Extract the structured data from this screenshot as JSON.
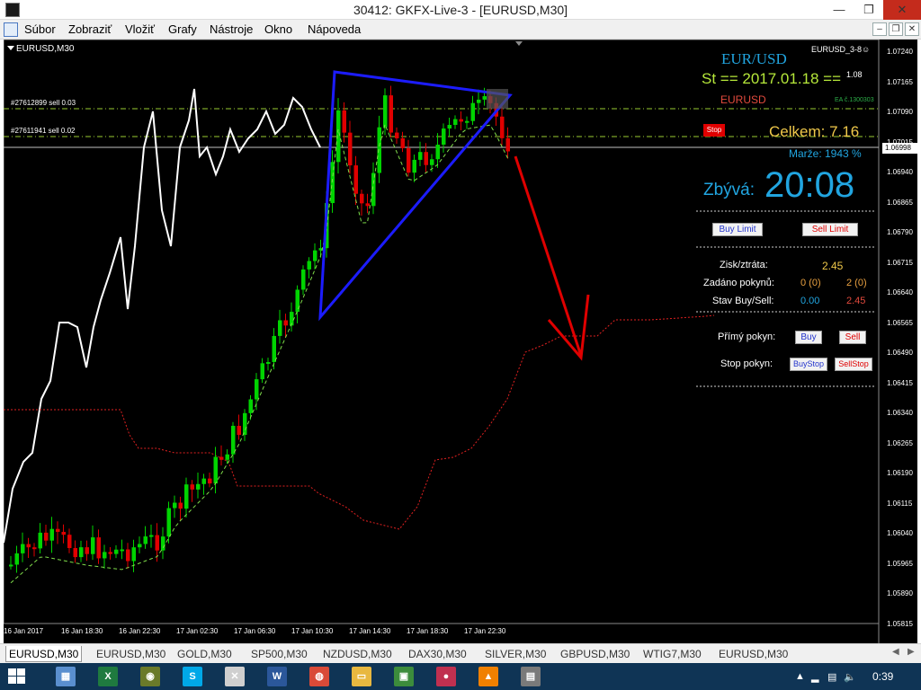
{
  "window": {
    "title": "30412: GKFX-Live-3 - [EURUSD,M30]",
    "min_glyph": "—",
    "max_glyph": "❐",
    "close_glyph": "✕"
  },
  "menu": {
    "items": [
      "Súbor",
      "Zobraziť",
      "Vložiť",
      "Grafy",
      "Nástroje",
      "Okno",
      "Nápoveda"
    ],
    "mdi_min": "–",
    "mdi_restore": "❐",
    "mdi_close": "✕"
  },
  "chart": {
    "symbol_label": "EURUSD,M30",
    "ea_name": "EURUSD_3-8☺",
    "orders": [
      "#27612899 sell 0.03",
      "#27611941 sell 0.02"
    ],
    "price_ticks": [
      "1.07240",
      "1.07165",
      "1.07090",
      "1.07015",
      "1.06940",
      "1.06865",
      "1.06790",
      "1.06715",
      "1.06640",
      "1.06565",
      "1.06490",
      "1.06415",
      "1.06340",
      "1.06265",
      "1.06190",
      "1.06115",
      "1.06040",
      "1.05965",
      "1.05890",
      "1.05815"
    ],
    "current_price": "1.06998",
    "time_ticks": [
      "16 Jan 2017",
      "16 Jan 18:30",
      "16 Jan 22:30",
      "17 Jan 02:30",
      "17 Jan 06:30",
      "17 Jan 10:30",
      "17 Jan 14:30",
      "17 Jan 18:30",
      "17 Jan 22:30"
    ],
    "colors": {
      "bull": "#00d400",
      "bear": "#e00000",
      "triangle": "#1c1cff",
      "arrow": "#e00000",
      "white_line": "#ffffff",
      "ichimoku": "#e02020"
    }
  },
  "panel": {
    "pair": "EUR/USD",
    "date_line": "St  ==  2017.01.18  ==",
    "date_suffix": "1.08",
    "eurusd": "EURUSD",
    "ea_number": "EA č.1300303",
    "stop_button": "Stop",
    "celkem": "Celkem: 7.16",
    "marze": "Marže:  1943  %",
    "zbyva_label": "Zbývá:",
    "zbyva_time": "20:08",
    "buy_limit": "Buy Limit",
    "sell_limit": "Sell Limit",
    "zisk_label": "Zisk/ztráta:",
    "zisk_value": "2.45",
    "zadano_label": "Zadáno pokynů:",
    "zadano_buy": "0 (0)",
    "zadano_sell": "2 (0)",
    "stav_label": "Stav Buy/Sell:",
    "stav_buy": "0.00",
    "stav_sell": "2.45",
    "primy_label": "Přímý pokyn:",
    "buy": "Buy",
    "sell": "Sell",
    "stop_label": "Stop pokyn:",
    "buy_stop": "BuyStop",
    "sell_stop": "SellStop"
  },
  "tabs": {
    "items": [
      "EURUSD,M30",
      "EURUSD,M30",
      "GOLD,M30",
      "SP500,M30",
      "NZDUSD,M30",
      "DAX30,M30",
      "SILVER,M30",
      "GBPUSD,M30",
      "WTIG7,M30",
      "EURUSD,M30"
    ],
    "active": 0,
    "scroll_left": "◀",
    "scroll_right": "▶"
  },
  "taskbar": {
    "clock": "0:39",
    "apps": [
      {
        "icon": "explorer-icon",
        "glyph": "▦",
        "color": "#5a8fcf"
      },
      {
        "icon": "excel-icon",
        "glyph": "X",
        "color": "#1f7a3f"
      },
      {
        "icon": "globe-app-icon",
        "glyph": "◉",
        "color": "#6a7a2a"
      },
      {
        "icon": "skype-icon",
        "glyph": "S",
        "color": "#00a8e8"
      },
      {
        "icon": "metatrader-icon",
        "glyph": "✕",
        "color": "#cfcfcf"
      },
      {
        "icon": "word-icon",
        "glyph": "W",
        "color": "#2b579a"
      },
      {
        "icon": "chrome-icon",
        "glyph": "◍",
        "color": "#d94a38"
      },
      {
        "icon": "folder-icon",
        "glyph": "▭",
        "color": "#e8b840"
      },
      {
        "icon": "photo-viewer-icon",
        "glyph": "▣",
        "color": "#3c8c3c"
      },
      {
        "icon": "dots-app-icon",
        "glyph": "●",
        "color": "#c03050"
      },
      {
        "icon": "vlc-icon",
        "glyph": "▲",
        "color": "#f08000"
      },
      {
        "icon": "text-editor-icon",
        "glyph": "▤",
        "color": "#7a7a7a"
      }
    ],
    "tray": [
      "▲",
      "▂",
      "▤",
      "🔈"
    ]
  }
}
